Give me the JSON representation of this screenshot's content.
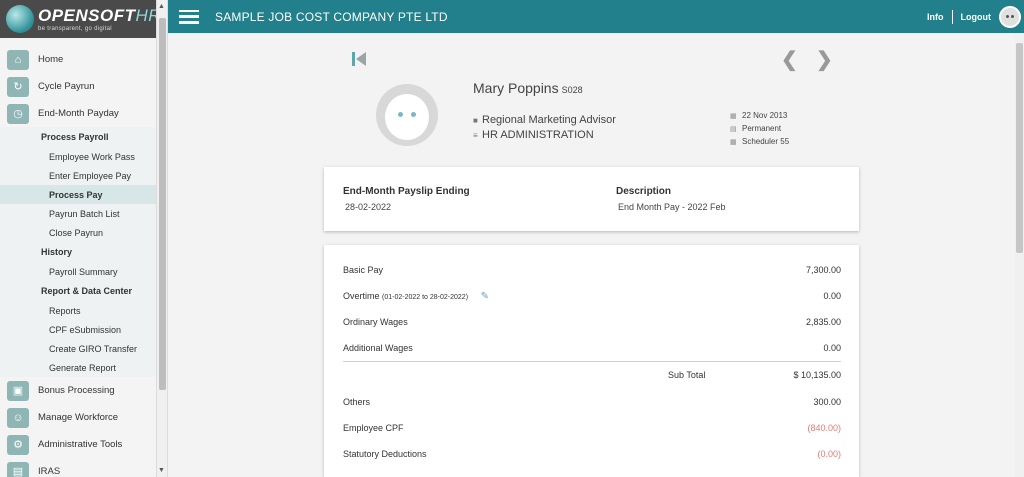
{
  "brand": {
    "name_main": "OPENSOFT",
    "name_hr": "HR",
    "tagline": "be transparent, go digital"
  },
  "topbar": {
    "company": "SAMPLE JOB COST COMPANY PTE LTD",
    "info": "Info",
    "logout": "Logout"
  },
  "sidebar": {
    "items_top": [
      {
        "label": "Home",
        "icon": "home-icon",
        "glyph": "⌂"
      },
      {
        "label": "Cycle Payrun",
        "icon": "cycle-icon",
        "glyph": "↻"
      },
      {
        "label": "End-Month Payday",
        "icon": "calendar-icon",
        "glyph": "◷"
      }
    ],
    "submenu": [
      {
        "type": "head",
        "label": "Process Payroll"
      },
      {
        "type": "item",
        "label": "Employee Work Pass"
      },
      {
        "type": "item",
        "label": "Enter Employee Pay"
      },
      {
        "type": "item",
        "label": "Process Pay",
        "active": true
      },
      {
        "type": "item",
        "label": "Payrun Batch List"
      },
      {
        "type": "item",
        "label": "Close Payrun"
      },
      {
        "type": "head",
        "label": "History"
      },
      {
        "type": "item",
        "label": "Payroll Summary"
      },
      {
        "type": "head",
        "label": "Report & Data Center"
      },
      {
        "type": "item",
        "label": "Reports"
      },
      {
        "type": "item",
        "label": "CPF eSubmission"
      },
      {
        "type": "item",
        "label": "Create GIRO Transfer"
      },
      {
        "type": "item",
        "label": "Generate Report"
      }
    ],
    "items_bottom": [
      {
        "label": "Bonus Processing",
        "icon": "bonus-icon",
        "glyph": "▣"
      },
      {
        "label": "Manage Workforce",
        "icon": "people-icon",
        "glyph": "☺"
      },
      {
        "label": "Administrative Tools",
        "icon": "gear-icon",
        "glyph": "⚙"
      },
      {
        "label": "IRAS",
        "icon": "document-icon",
        "glyph": "▤"
      }
    ]
  },
  "employee": {
    "name": "Mary Poppins",
    "code": "S028",
    "position": "Regional Marketing Advisor",
    "department": "HR ADMINISTRATION",
    "join_date": "22 Nov 2013",
    "type": "Permanent",
    "scheduler": "Scheduler 55"
  },
  "payslip": {
    "ending_label": "End-Month Payslip Ending",
    "ending_date": "28-02-2022",
    "description_label": "Description",
    "description": "End Month Pay - 2022 Feb"
  },
  "lines": {
    "basic_pay": {
      "label": "Basic Pay",
      "amount": "7,300.00"
    },
    "overtime": {
      "label": "Overtime",
      "period": "(01-02-2022 to 28-02-2022)",
      "amount": "0.00"
    },
    "ordinary_wages": {
      "label": "Ordinary Wages",
      "amount": "2,835.00"
    },
    "additional_wages": {
      "label": "Additional Wages",
      "amount": "0.00"
    },
    "subtotal": {
      "label": "Sub Total",
      "amount": "$ 10,135.00"
    },
    "others": {
      "label": "Others",
      "amount": "300.00"
    },
    "employee_cpf": {
      "label": "Employee CPF",
      "amount": "(840.00)"
    },
    "statutory": {
      "label": "Statutory Deductions",
      "amount": "(0.00)"
    }
  },
  "colors": {
    "accent": "#21808b",
    "negative": "#e07a7a",
    "sidebar_active": "#d7e7e7"
  }
}
